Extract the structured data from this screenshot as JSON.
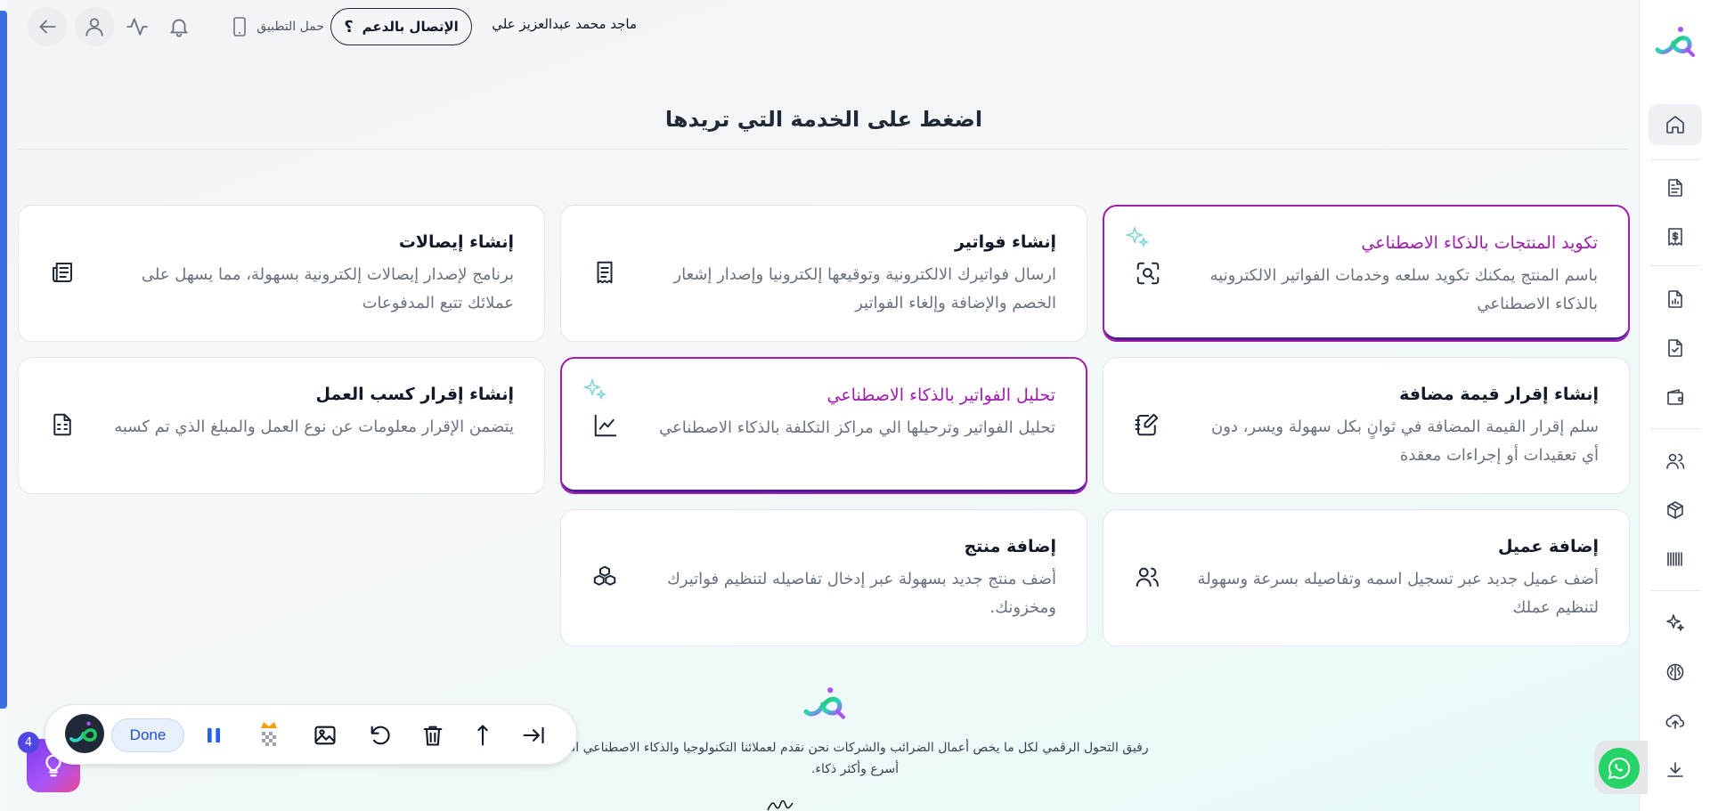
{
  "header": {
    "user_name": "ماجد محمد عبدالعزيز علي",
    "support_label": "الإتصال بالدعم",
    "support_glyph": "؟",
    "app_link_label": "حمل التطبيق"
  },
  "page": {
    "title": "اضغط على الخدمة التي تريدها"
  },
  "cards": [
    {
      "title": "تكويد المنتجات بالذكاء الاصطناعي",
      "description": "باسم المنتج يمكنك تكويد سلعه وخدمات الفواتير الالكترونيه بالذكاء الاصطناعي",
      "icon": "scan-search-icon",
      "ai": true
    },
    {
      "title": "إنشاء فواتير",
      "description": "ارسال فواتيرك الالكترونية وتوقيعها إلكترونيا وإصدار إشعار الخصم والإضافة وإلغاء الفواتير",
      "icon": "receipt-icon",
      "ai": false
    },
    {
      "title": "إنشاء إيصالات",
      "description": "برنامج لإصدار إيصالات إلكترونية بسهولة، مما يسهل على عملائك تتبع المدفوعات",
      "icon": "newspaper-icon",
      "ai": false
    },
    {
      "title": "إنشاء إقرار قيمة مضافة",
      "description": "سلم إقرار القيمة المضافة في ثوانٍ بكل سهولة ويسر، دون أي تعقيدات أو إجراءات معقدة",
      "icon": "notebook-pen-icon",
      "ai": false
    },
    {
      "title": "تحليل الفواتير بالذكاء الاصطناعي",
      "description": "تحليل الفواتير وترحيلها الي مراكز التكلفة بالذكاء الاصطناعي",
      "icon": "line-chart-icon",
      "ai": true
    },
    {
      "title": "إنشاء إقرار كسب العمل",
      "description": "يتضمن الإقرار معلومات عن نوع العمل والمبلغ الذي تم كسبه",
      "icon": "file-spreadsheet-icon",
      "ai": false
    },
    {
      "title": "إضافة عميل",
      "description": "أضف عميل جديد عبر تسجيل اسمه وتفاصيله بسرعة وسهولة لتنظيم عملك",
      "icon": "users-icon",
      "ai": false
    },
    {
      "title": "إضافة منتج",
      "description": "أضف منتج جديد بسهولة عبر إدخال تفاصيله لتنظيم فواتيرك ومخزونك.",
      "icon": "boxes-icon",
      "ai": false
    }
  ],
  "footer": {
    "text": "رفيق التحول الرقمي لكل ما يخص أعمال الضرائب والشركات نحن نقدم لعملائنا التكنولوجيا والذكاء الاصطناعي الي أسرع وأكثر ذكاء."
  },
  "toolbar": {
    "done_label": "Done",
    "badge_count": "4"
  },
  "colors": {
    "accent_blue": "#3b6ee0",
    "ai_border": "#a21caf",
    "brand_teal": "#2dd4bf",
    "brand_green": "#22c55e",
    "brand_purple": "#a855f7",
    "whatsapp": "#25d366"
  }
}
